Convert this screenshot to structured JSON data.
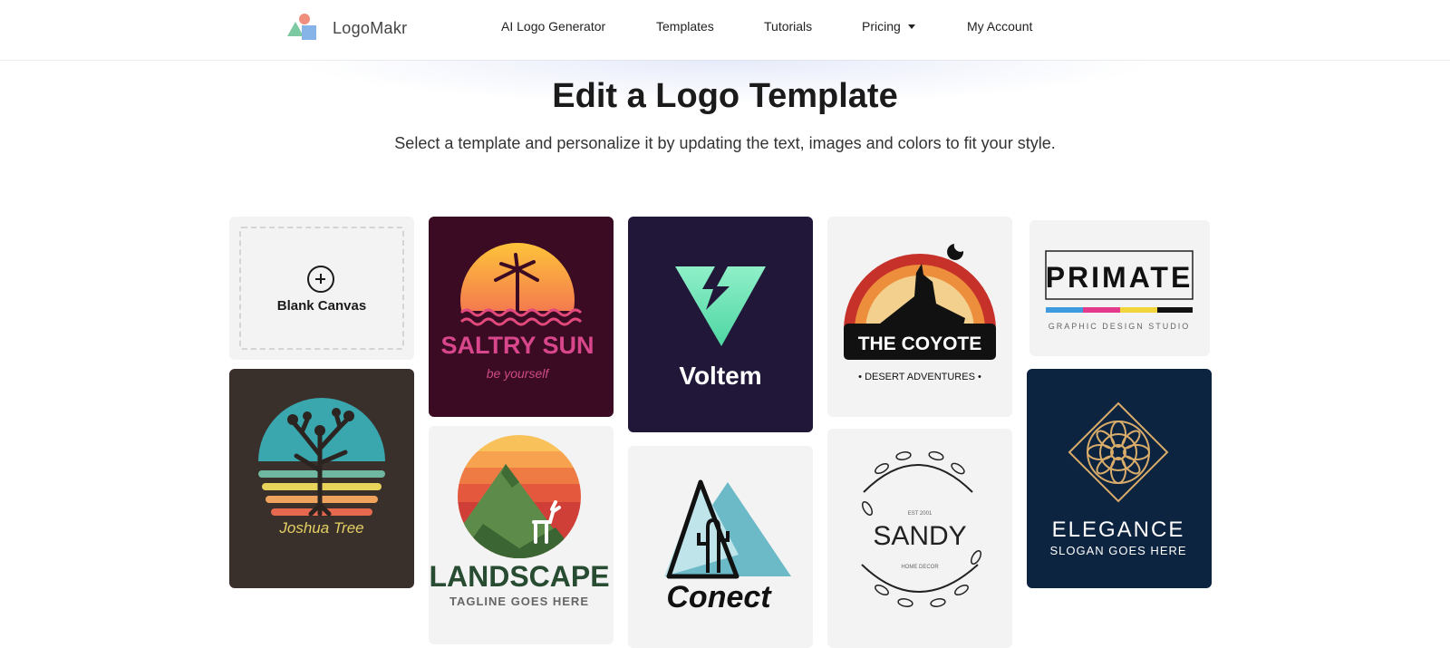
{
  "header": {
    "logo_text": "LogoMakr",
    "nav": [
      {
        "label": "AI Logo Generator"
      },
      {
        "label": "Templates"
      },
      {
        "label": "Tutorials"
      },
      {
        "label": "Pricing"
      },
      {
        "label": "My Account"
      }
    ]
  },
  "hero": {
    "title": "Edit a Logo Template",
    "subtitle": "Select a template and personalize it by updating the text, images and colors to fit your style."
  },
  "templates": {
    "blank": {
      "label": "Blank Canvas"
    },
    "joshua_tree": {
      "name": "Joshua Tree",
      "bg": "#3a302b"
    },
    "saltry_sun": {
      "name": "SALTRY SUN",
      "tagline": "be yourself",
      "bg": "#3a0b22"
    },
    "landscape": {
      "name": "LANDSCAPE",
      "tagline": "TAGLINE GOES HERE"
    },
    "voltem": {
      "name": "Voltem",
      "bg": "#201739"
    },
    "conect": {
      "name": "Conect"
    },
    "coyote": {
      "name": "THE COYOTE",
      "tagline": "• DESERT ADVENTURES •"
    },
    "sandy": {
      "name": "SANDY",
      "est": "EST 2001",
      "tagline": "HOME DECOR"
    },
    "primate": {
      "name": "PRIMATE",
      "tagline": "GRAPHIC DESIGN STUDIO"
    },
    "elegance": {
      "name": "ELEGANCE",
      "tagline": "SLOGAN GOES HERE",
      "bg": "#0d2440"
    }
  },
  "colors": {
    "accent_teal": "#6ccbb0",
    "accent_coral": "#f28d7b",
    "accent_blue": "#7fb2e6"
  }
}
